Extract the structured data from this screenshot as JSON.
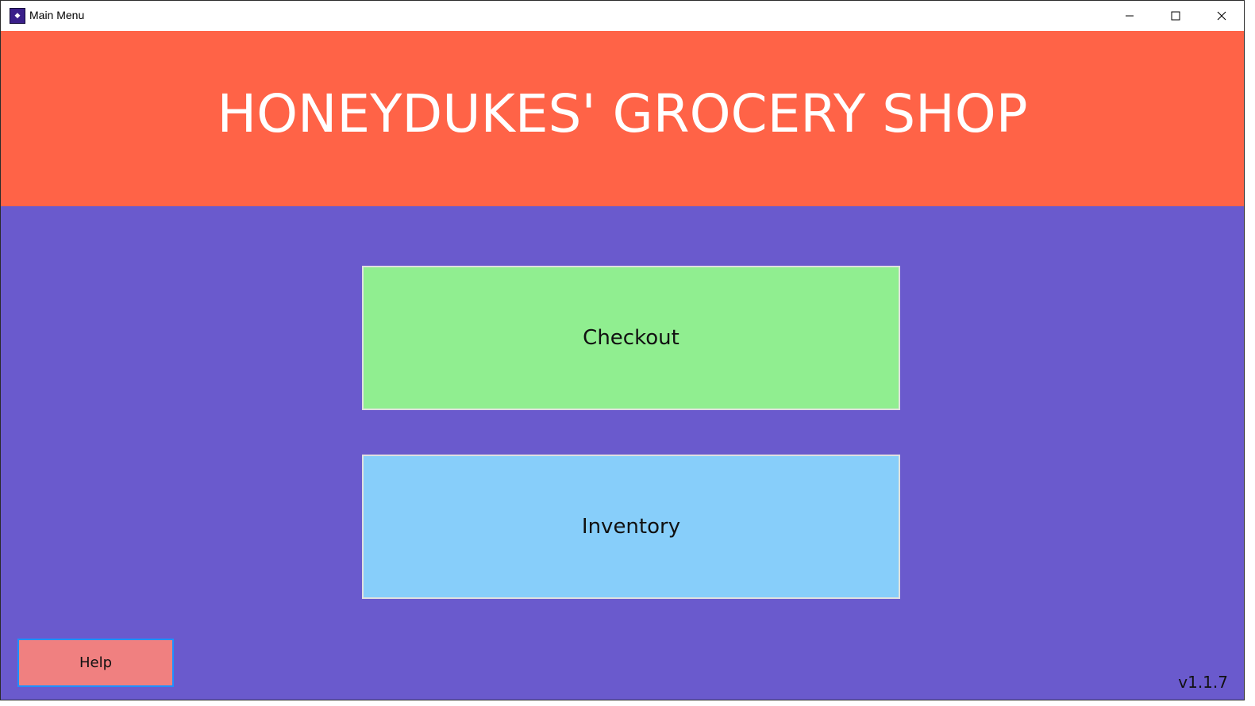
{
  "window": {
    "title": "Main Menu",
    "icon": "app-icon"
  },
  "header": {
    "title": "HONEYDUKES' GROCERY SHOP"
  },
  "main": {
    "checkout_label": "Checkout",
    "inventory_label": "Inventory"
  },
  "footer": {
    "help_label": "Help",
    "version": "v1.1.7"
  },
  "colors": {
    "background": "#6a5acd",
    "header": "#ff6347",
    "checkout": "#90ee90",
    "inventory": "#87cefa",
    "help": "#f08080",
    "help_border": "#1e90ff"
  }
}
